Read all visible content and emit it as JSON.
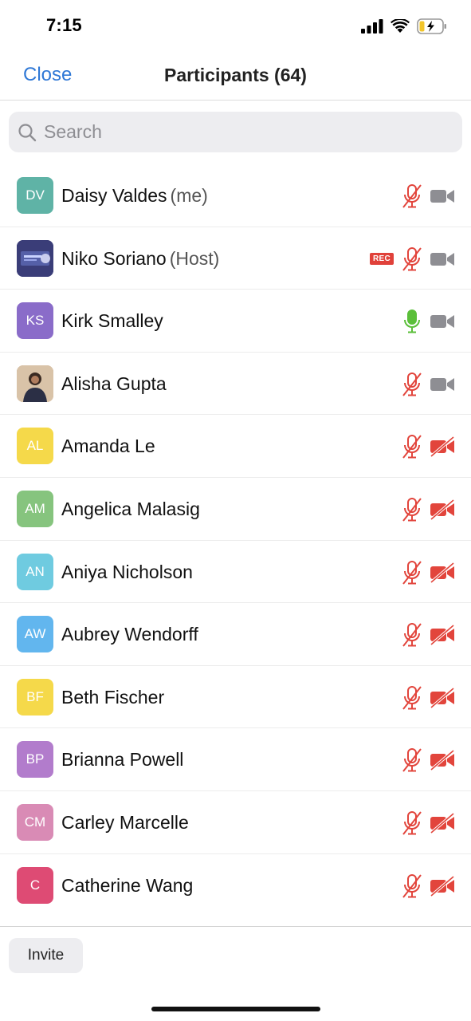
{
  "status_bar": {
    "time": "7:15",
    "icons": [
      "signal-icon",
      "wifi-icon",
      "battery-charging-icon"
    ]
  },
  "nav": {
    "close_label": "Close",
    "title": "Participants (64)"
  },
  "search": {
    "placeholder": "Search",
    "value": ""
  },
  "participants": [
    {
      "initials": "DV",
      "name": "Daisy Valdes",
      "role": "(me)",
      "avatar_color": "#5fb3a6",
      "mic": "muted",
      "camera": "on",
      "rec": ""
    },
    {
      "initials": "",
      "name": "Niko Soriano",
      "role": "(Host)",
      "avatar_color": "#3c3f7a",
      "avatar_type": "image",
      "mic": "muted",
      "camera": "on",
      "rec": "REC"
    },
    {
      "initials": "KS",
      "name": "Kirk Smalley",
      "role": "",
      "avatar_color": "#8a6cc9",
      "mic": "active",
      "camera": "on",
      "rec": ""
    },
    {
      "initials": "",
      "name": "Alisha Gupta",
      "role": "",
      "avatar_color": "#c9a88a",
      "avatar_type": "photo",
      "mic": "muted",
      "camera": "on",
      "rec": ""
    },
    {
      "initials": "AL",
      "name": "Amanda Le",
      "role": "",
      "avatar_color": "#f5d94a",
      "mic": "muted",
      "camera": "off",
      "rec": ""
    },
    {
      "initials": "AM",
      "name": "Angelica Malasig",
      "role": "",
      "avatar_color": "#86c47e",
      "mic": "muted",
      "camera": "off",
      "rec": ""
    },
    {
      "initials": "AN",
      "name": "Aniya Nicholson",
      "role": "",
      "avatar_color": "#6fcbe0",
      "mic": "muted",
      "camera": "off",
      "rec": ""
    },
    {
      "initials": "AW",
      "name": "Aubrey Wendorff",
      "role": "",
      "avatar_color": "#62b6ee",
      "mic": "muted",
      "camera": "off",
      "rec": ""
    },
    {
      "initials": "BF",
      "name": "Beth Fischer",
      "role": "",
      "avatar_color": "#f5d94a",
      "mic": "muted",
      "camera": "off",
      "rec": ""
    },
    {
      "initials": "BP",
      "name": "Brianna Powell",
      "role": "",
      "avatar_color": "#b27ccc",
      "mic": "muted",
      "camera": "off",
      "rec": ""
    },
    {
      "initials": "CM",
      "name": "Carley Marcelle",
      "role": "",
      "avatar_color": "#d98bb5",
      "mic": "muted",
      "camera": "off",
      "rec": ""
    },
    {
      "initials": "C",
      "name": "Catherine Wang",
      "role": "",
      "avatar_color": "#de4b74",
      "mic": "muted",
      "camera": "off",
      "rec": ""
    }
  ],
  "footer": {
    "invite_label": "Invite"
  },
  "colors": {
    "accent": "#2f78d6",
    "muted_red": "#e2453c",
    "active_green": "#5bbf3a",
    "camera_gray": "#8e8e93"
  }
}
